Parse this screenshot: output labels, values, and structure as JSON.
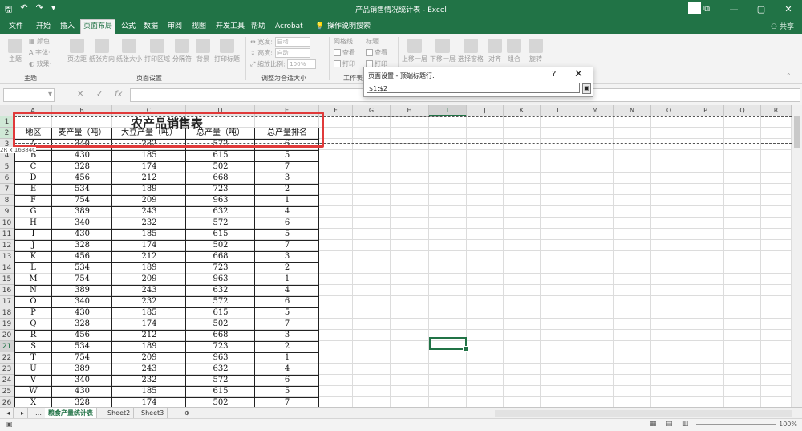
{
  "window": {
    "title": "产品销售情况统计表 - Excel",
    "user": "",
    "controls": [
      "—",
      "▢",
      "✕"
    ]
  },
  "ribbon": {
    "tabs": [
      {
        "label": "文件"
      },
      {
        "label": "开始"
      },
      {
        "label": "插入"
      },
      {
        "label": "页面布局",
        "active": true
      },
      {
        "label": "公式"
      },
      {
        "label": "数据"
      },
      {
        "label": "审阅"
      },
      {
        "label": "视图"
      },
      {
        "label": "开发工具"
      },
      {
        "label": "帮助"
      },
      {
        "label": "Acrobat"
      },
      {
        "label": "操作说明搜索"
      }
    ],
    "share": "共享",
    "groups": {
      "theme": {
        "label": "主题",
        "big": "主题",
        "small": [
          "颜色·",
          "字体·",
          "效果·"
        ]
      },
      "page_setup": {
        "label": "页面设置",
        "buttons": [
          "页边距",
          "纸张方向",
          "纸张大小",
          "打印区域",
          "分隔符",
          "背景",
          "打印标题"
        ]
      },
      "scale": {
        "label": "调整为合适大小",
        "width_label": "宽度:",
        "width_value": "自动",
        "height_label": "高度:",
        "height_value": "自动",
        "scale_label": "缩放比例:",
        "scale_value": "100%"
      },
      "sheet_options": {
        "label": "工作表选",
        "gridlines": "网格线",
        "headings": "标题",
        "view1": "查看",
        "view2": "查看",
        "print1": "打印",
        "print2": "打印"
      },
      "arrange": {
        "buttons": [
          "上移一层",
          "下移一层",
          "选择窗格",
          "对齐",
          "组合",
          "旋转"
        ]
      }
    }
  },
  "formula_bar": {
    "name_box": "",
    "cancel": "✕",
    "enter": "✓",
    "fx": "fx",
    "value": ""
  },
  "dialog": {
    "title": "页面设置 - 顶端标题行:",
    "help": "?",
    "close": "✕",
    "value": "$1:$2"
  },
  "grid": {
    "columns": [
      "A",
      "B",
      "C",
      "D",
      "E",
      "F",
      "G",
      "H",
      "I",
      "J",
      "K",
      "L",
      "M",
      "N",
      "O",
      "P",
      "Q",
      "R"
    ],
    "selected_column": "I",
    "row_numbers": [
      "1",
      "2",
      "3",
      "4",
      "5",
      "6",
      "7",
      "8",
      "9",
      "10",
      "11",
      "12",
      "13",
      "14",
      "15",
      "16",
      "17",
      "18",
      "19",
      "20",
      "21",
      "22",
      "23",
      "24",
      "25",
      "26"
    ],
    "selected_row": "21",
    "tooltip": "2R x 16384C",
    "table_title": "农产品销售表",
    "headers": [
      "地区",
      "麦产量（吨）",
      "大豆产量（吨）",
      "总产量（吨）",
      "总产量排名"
    ],
    "rows": [
      [
        "A",
        "340",
        "232",
        "572",
        "6"
      ],
      [
        "B",
        "430",
        "185",
        "615",
        "5"
      ],
      [
        "C",
        "328",
        "174",
        "502",
        "7"
      ],
      [
        "D",
        "456",
        "212",
        "668",
        "3"
      ],
      [
        "E",
        "534",
        "189",
        "723",
        "2"
      ],
      [
        "F",
        "754",
        "209",
        "963",
        "1"
      ],
      [
        "G",
        "389",
        "243",
        "632",
        "4"
      ],
      [
        "H",
        "340",
        "232",
        "572",
        "6"
      ],
      [
        "I",
        "430",
        "185",
        "615",
        "5"
      ],
      [
        "J",
        "328",
        "174",
        "502",
        "7"
      ],
      [
        "K",
        "456",
        "212",
        "668",
        "3"
      ],
      [
        "L",
        "534",
        "189",
        "723",
        "2"
      ],
      [
        "M",
        "754",
        "209",
        "963",
        "1"
      ],
      [
        "N",
        "389",
        "243",
        "632",
        "4"
      ],
      [
        "O",
        "340",
        "232",
        "572",
        "6"
      ],
      [
        "P",
        "430",
        "185",
        "615",
        "5"
      ],
      [
        "Q",
        "328",
        "174",
        "502",
        "7"
      ],
      [
        "R",
        "456",
        "212",
        "668",
        "3"
      ],
      [
        "S",
        "534",
        "189",
        "723",
        "2"
      ],
      [
        "T",
        "754",
        "209",
        "963",
        "1"
      ],
      [
        "U",
        "389",
        "243",
        "632",
        "4"
      ],
      [
        "V",
        "340",
        "232",
        "572",
        "6"
      ],
      [
        "W",
        "430",
        "185",
        "615",
        "5"
      ],
      [
        "X",
        "328",
        "174",
        "502",
        "7"
      ]
    ]
  },
  "sheets": [
    {
      "label": "粮食产量统计表",
      "active": true
    },
    {
      "label": "Sheet2"
    },
    {
      "label": "Sheet3"
    }
  ],
  "add_sheet": "⊕",
  "status": {
    "zoom": "100%"
  },
  "colors": {
    "excel_green": "#217346",
    "highlight_red": "#e03a3a"
  }
}
